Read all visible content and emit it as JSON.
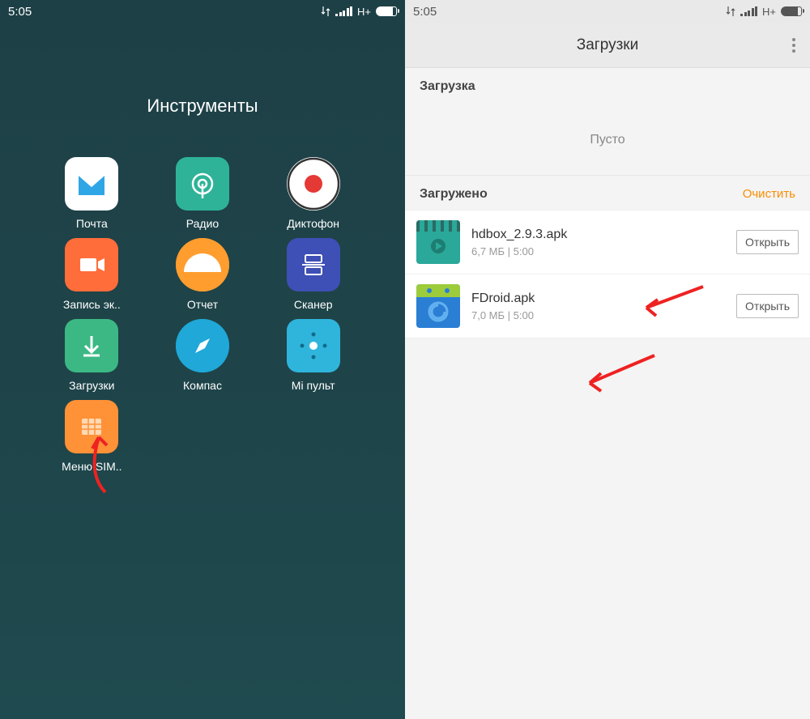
{
  "left": {
    "status": {
      "time": "5:05",
      "network": "H+"
    },
    "folderTitle": "Инструменты",
    "apps": [
      {
        "label": "Почта",
        "icon": "mail"
      },
      {
        "label": "Радио",
        "icon": "radio"
      },
      {
        "label": "Диктофон",
        "icon": "recorder"
      },
      {
        "label": "Запись эк..",
        "icon": "screenrec"
      },
      {
        "label": "Отчет",
        "icon": "feedback"
      },
      {
        "label": "Сканер",
        "icon": "scanner"
      },
      {
        "label": "Загрузки",
        "icon": "downloads"
      },
      {
        "label": "Компас",
        "icon": "compass"
      },
      {
        "label": "Mi пульт",
        "icon": "remote"
      },
      {
        "label": "Меню SIM..",
        "icon": "sim"
      }
    ]
  },
  "right": {
    "status": {
      "time": "5:05",
      "network": "H+"
    },
    "headerTitle": "Загрузки",
    "inProgress": {
      "title": "Загрузка",
      "empty": "Пусто"
    },
    "completed": {
      "title": "Загружено",
      "clear": "Очистить",
      "items": [
        {
          "name": "hdbox_2.9.3.apk",
          "meta": "6,7 МБ | 5:00",
          "thumb": "video",
          "action": "Открыть"
        },
        {
          "name": "FDroid.apk",
          "meta": "7,0 МБ | 5:00",
          "thumb": "fdroid",
          "action": "Открыть"
        }
      ]
    }
  }
}
